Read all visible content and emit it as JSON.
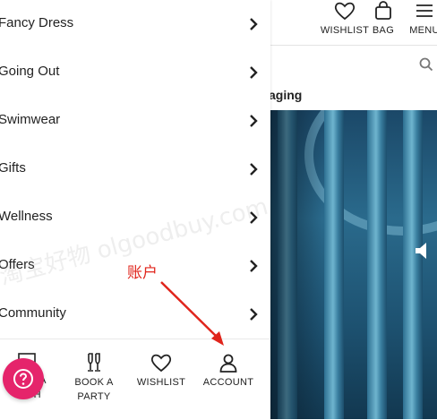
{
  "header": {
    "wishlist_label": "WISHLIST",
    "bag_label": "BAG",
    "menu_label": "MENU"
  },
  "promo": {
    "text": "aging"
  },
  "drawer": {
    "items": [
      {
        "label": "Fancy Dress"
      },
      {
        "label": "Going Out"
      },
      {
        "label": "Swimwear"
      },
      {
        "label": "Gifts"
      },
      {
        "label": "Wellness"
      },
      {
        "label": "Offers"
      },
      {
        "label": "Community"
      }
    ]
  },
  "bottom_bar": {
    "cash_label_1": "ERA",
    "cash_label_2": "CASH",
    "party_label_1": "BOOK A",
    "party_label_2": "PARTY",
    "wishlist_label": "WISHLIST",
    "account_label": "ACCOUNT"
  },
  "annotation": {
    "text": "账户",
    "color": "#e0251c"
  },
  "watermark": {
    "text": "淘宝好物 olgoodbuy.com"
  },
  "colors": {
    "help_bubble": "#e5246b",
    "text": "#222222"
  }
}
